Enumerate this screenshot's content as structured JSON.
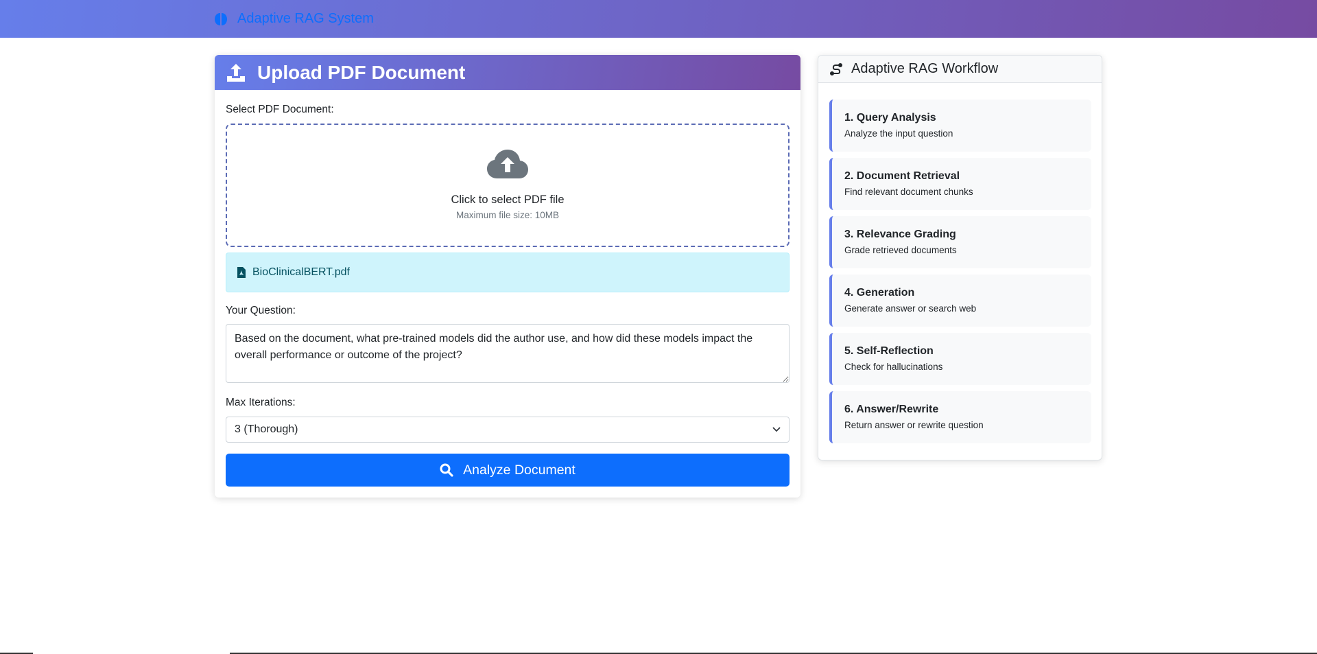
{
  "app": {
    "title": "Adaptive RAG System",
    "icon": "brain-icon"
  },
  "upload": {
    "header": "Upload PDF Document",
    "header_icon": "upload-icon",
    "select_label": "Select PDF Document:",
    "dropzone_title": "Click to select PDF file",
    "dropzone_sub": "Maximum file size: 10MB",
    "selected_file": "BioClinicalBERT.pdf",
    "question_label": "Your Question:",
    "question_value": "Based on the document, what pre-trained models did the author use, and how did these models impact the overall performance or outcome of the project?",
    "iterations_label": "Max Iterations:",
    "iterations_value": "3 (Thorough)",
    "analyze_label": "Analyze Document"
  },
  "workflow": {
    "title": "Adaptive RAG Workflow",
    "steps": [
      {
        "title": "1. Query Analysis",
        "desc": "Analyze the input question"
      },
      {
        "title": "2. Document Retrieval",
        "desc": "Find relevant document chunks"
      },
      {
        "title": "3. Relevance Grading",
        "desc": "Grade retrieved documents"
      },
      {
        "title": "4. Generation",
        "desc": "Generate answer or search web"
      },
      {
        "title": "5. Self-Reflection",
        "desc": "Check for hallucinations"
      },
      {
        "title": "6. Answer/Rewrite",
        "desc": "Return answer or rewrite question"
      }
    ]
  },
  "colors": {
    "accent_start": "#667eea",
    "accent_end": "#764ba2",
    "primary": "#0d6efd",
    "info_bg": "#cff4fc"
  }
}
